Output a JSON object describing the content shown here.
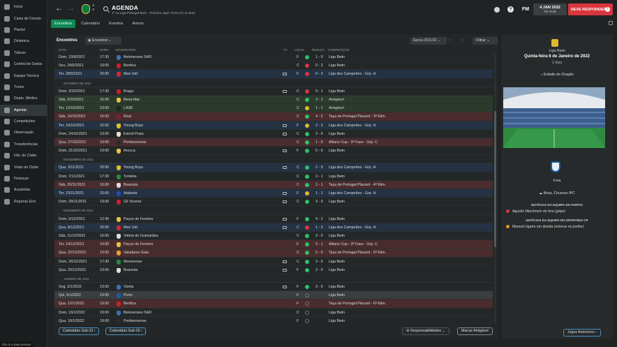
{
  "sidebar": {
    "items": [
      {
        "label": "Início",
        "active": false
      },
      {
        "label": "Caixa de Correio",
        "active": false
      },
      {
        "label": "Plantel",
        "active": false
      },
      {
        "label": "Dinâmica",
        "active": false
      },
      {
        "label": "Táticas",
        "active": false
      },
      {
        "label": "Central de Dados",
        "active": false
      },
      {
        "label": "Equipa Técnica",
        "active": false
      },
      {
        "label": "Treino",
        "active": false
      },
      {
        "label": "Depto. Médico",
        "active": false
      },
      {
        "label": "Agenda",
        "active": true
      },
      {
        "label": "Competições",
        "active": false
      },
      {
        "label": "Observação",
        "active": false
      },
      {
        "label": "Transferências",
        "active": false
      },
      {
        "label": "Info. do Clube",
        "active": false
      },
      {
        "label": "Visão do Clube",
        "active": false
      },
      {
        "label": "Finanças",
        "active": false
      },
      {
        "label": "Academia",
        "active": false
      },
      {
        "label": "Reportar Erro",
        "active": false
      }
    ],
    "beta_note": "This is a beta version"
  },
  "header": {
    "title": "AGENDA",
    "subtitle": "1º na Liga Portugal Bwin · Próximo Jogo: Porto (F) (2 dias)",
    "date": "4 JAN 2022",
    "time": "Ter 9:45",
    "fm_logo": "FM",
    "continue_label": "DEVE RESPONDER"
  },
  "tabs": [
    "Encontros",
    "Calendário",
    "Eventos",
    "Avisos"
  ],
  "main": {
    "heading": "Encontros",
    "filter_value": "Encontros",
    "season": "Época 2021/22",
    "filter_button": "Filtrar",
    "columns": [
      "DATA",
      "HORA",
      "ADVERSÁRIO",
      "TV",
      "LOCAL",
      "RESULT...",
      "COMPETIÇÃO"
    ],
    "rows": [
      {
        "type": "match",
        "date": "Dom, 19/9/2021",
        "time": "17:30",
        "opp": "Belenenses SAD",
        "tv": "",
        "venue": "F",
        "result": "1 - 0",
        "comp": "Liga Bwin",
        "tone": "",
        "crest": "#3b6fb6",
        "dot": "#2fbf6a"
      },
      {
        "type": "match",
        "date": "Sex, 24/9/2021",
        "time": "19:00",
        "opp": "Benfica",
        "tv": "",
        "venue": "C",
        "result": "0 - 2",
        "comp": "Liga Bwin",
        "tone": "",
        "crest": "#c8202a",
        "dot": "#d9363e"
      },
      {
        "type": "match",
        "date": "Ter, 28/9/2021",
        "time": "20:00",
        "opp": "Man Utd",
        "tv": "yes",
        "venue": "F",
        "result": "0 - 3",
        "comp": "Liga dos Campeões - Grp. H",
        "tone": "ts-cl",
        "crest": "#d42a2a",
        "dot": "#d9363e"
      },
      {
        "type": "month",
        "label": "OUTUBRO DE 2021"
      },
      {
        "type": "match",
        "date": "Dom, 3/10/2021",
        "time": "17:30",
        "opp": "Braga",
        "tv": "yes",
        "venue": "C",
        "result": "0 - 1",
        "comp": "Liga Bwin",
        "tone": "",
        "crest": "#c8202a",
        "dot": "#d9363e"
      },
      {
        "type": "match",
        "date": "Sáb, 9/10/2021",
        "time": "16:00",
        "opp": "Beira-Mar",
        "tv": "",
        "venue": "C",
        "result": "3 - 1",
        "comp": "Amigável",
        "tone": "ts-friendly",
        "crest": "#e8c240",
        "dot": "#2fbf6a"
      },
      {
        "type": "match",
        "date": "Ter, 12/10/2021",
        "time": "19:00",
        "opp": "LASK",
        "tv": "",
        "venue": "C",
        "result": "1 - 1",
        "comp": "Amigável",
        "tone": "ts-friendly",
        "crest": "#222",
        "dot": "#e0b92a"
      },
      {
        "type": "match",
        "date": "Sáb, 16/10/2021",
        "time": "16:00",
        "opp": "Real",
        "tv": "",
        "venue": "C",
        "result": "4 - 2",
        "comp": "Taça de Portugal Placard - 3ª Elim.",
        "tone": "ts-cup",
        "crest": "#7a2030",
        "dot": "#2fbf6a"
      },
      {
        "type": "match",
        "date": "Ter, 19/10/2021",
        "time": "20:00",
        "opp": "Young Boys",
        "tv": "yes",
        "venue": "F",
        "result": "2 - 2",
        "comp": "Liga dos Campeões - Grp. H",
        "tone": "ts-cl",
        "crest": "#e0c020",
        "dot": "#e0b92a"
      },
      {
        "type": "match",
        "date": "Dom, 24/10/2021",
        "time": "19:00",
        "opp": "Estoril Praia",
        "tv": "yes",
        "venue": "C",
        "result": "2 - 0",
        "comp": "Liga Bwin",
        "tone": "",
        "crest": "#e8e0d0",
        "dot": "#2fbf6a"
      },
      {
        "type": "match",
        "date": "Qua, 27/10/2021",
        "time": "19:00",
        "opp": "Portimonense",
        "tv": "",
        "venue": "C",
        "result": "1 - 0",
        "comp": "Allianz Cup - 3ª Fase - Grp. C",
        "tone": "ts-cup",
        "crest": "#2a2a2a",
        "dot": "#2fbf6a"
      },
      {
        "type": "match",
        "date": "Dom, 31/10/2021",
        "time": "19:00",
        "opp": "Arouca",
        "tv": "yes",
        "venue": "F",
        "result": "5 - 0",
        "comp": "Liga Bwin",
        "tone": "",
        "crest": "#e8c240",
        "dot": "#2fbf6a"
      },
      {
        "type": "month",
        "label": "NOVEMBRO DE 2021"
      },
      {
        "type": "match",
        "date": "Qua, 3/11/2021",
        "time": "20:00",
        "opp": "Young Boys",
        "tv": "yes",
        "venue": "C",
        "result": "2 - 0",
        "comp": "Liga dos Campeões - Grp. H",
        "tone": "ts-cl",
        "crest": "#e0c020",
        "dot": "#2fbf6a"
      },
      {
        "type": "match",
        "date": "Dom, 7/11/2021",
        "time": "17:30",
        "opp": "Tondela",
        "tv": "",
        "venue": "C",
        "result": "3 - 1",
        "comp": "Liga Bwin",
        "tone": "",
        "crest": "#2a8a3a",
        "dot": "#2fbf6a"
      },
      {
        "type": "match",
        "date": "Sáb, 20/11/2021",
        "time": "16:00",
        "opp": "Boavista",
        "tv": "",
        "venue": "C",
        "result": "2 - 1",
        "comp": "Taça de Portugal Placard - 4ª Elim.",
        "tone": "ts-cup",
        "crest": "#ddd",
        "dot": "#2fbf6a"
      },
      {
        "type": "match",
        "date": "Ter, 23/11/2021",
        "time": "20:00",
        "opp": "Atalanta",
        "tv": "yes",
        "venue": "F",
        "result": "1 - 1",
        "comp": "Liga dos Campeões - Grp. H",
        "tone": "ts-cl",
        "crest": "#2a4ab0",
        "dot": "#e0b92a"
      },
      {
        "type": "match",
        "date": "Dom, 28/11/2021",
        "time": "19:00",
        "opp": "Gil Vicente",
        "tv": "yes",
        "venue": "C",
        "result": "3 - 0",
        "comp": "Liga Bwin",
        "tone": "",
        "crest": "#c8202a",
        "dot": "#2fbf6a"
      },
      {
        "type": "month",
        "label": "DEZEMBRO DE 2021"
      },
      {
        "type": "match",
        "date": "Dom, 5/12/2021",
        "time": "12:45",
        "opp": "Paços de Ferreira",
        "tv": "yes",
        "venue": "F",
        "result": "4 - 2",
        "comp": "Liga Bwin",
        "tone": "",
        "crest": "#e8c240",
        "dot": "#2fbf6a"
      },
      {
        "type": "match",
        "date": "Qua, 8/12/2021",
        "time": "20:00",
        "opp": "Man Utd",
        "tv": "yes",
        "venue": "C",
        "result": "1 - 3",
        "comp": "Liga dos Campeões - Grp. H",
        "tone": "ts-cl",
        "crest": "#d42a2a",
        "dot": "#d9363e"
      },
      {
        "type": "match",
        "date": "Sáb, 11/12/2021",
        "time": "16:00",
        "opp": "Vitória de Guimarães",
        "tv": "",
        "venue": "C",
        "result": "3 - 0",
        "comp": "Liga Bwin",
        "tone": "",
        "crest": "#ddd",
        "dot": "#2fbf6a"
      },
      {
        "type": "match",
        "date": "Ter, 14/12/2021",
        "time": "19:00",
        "opp": "Paços de Ferreira",
        "tv": "",
        "venue": "F",
        "result": "3 - 1",
        "comp": "Allianz Cup - 3ª Fase - Grp. C",
        "tone": "ts-cup",
        "crest": "#e8c240",
        "dot": "#2fbf6a"
      },
      {
        "type": "match",
        "date": "Qua, 22/12/2021",
        "time": "19:00",
        "opp": "Valadares Gaia",
        "tv": "",
        "venue": "C",
        "result": "5 - 0",
        "comp": "Taça de Portugal Placard - 5ª Elim.",
        "tone": "ts-cup",
        "crest": "#e8a030",
        "dot": "#2fbf6a"
      },
      {
        "type": "match",
        "date": "Dom, 26/12/2021",
        "time": "17:30",
        "opp": "Moreirense",
        "tv": "yes",
        "venue": "C",
        "result": "3 - 0",
        "comp": "Liga Bwin",
        "tone": "",
        "crest": "#2a8a3a",
        "dot": "#2fbf6a"
      },
      {
        "type": "match",
        "date": "Qua, 29/12/2021",
        "time": "19:00",
        "opp": "Boavista",
        "tv": "yes",
        "venue": "F",
        "result": "2 - 0",
        "comp": "Liga Bwin",
        "tone": "",
        "crest": "#ddd",
        "dot": "#2fbf6a"
      },
      {
        "type": "month",
        "label": "JANEIRO DE 2022"
      },
      {
        "type": "match",
        "date": "Seg, 3/1/2022",
        "time": "19:00",
        "opp": "Vizela",
        "tv": "yes",
        "venue": "F",
        "result": "3 - 0",
        "comp": "Liga Bwin",
        "tone": "",
        "crest": "#3b6fb6",
        "dot": "#2fbf6a"
      },
      {
        "type": "match",
        "date": "Qui, 6/1/2022",
        "time": "19:00",
        "opp": "Porto",
        "tv": "",
        "venue": "F",
        "result": "",
        "comp": "Liga Bwin",
        "tone": "ts-next",
        "crest": "#1d5aa8",
        "dot": ""
      },
      {
        "type": "match",
        "date": "Qua, 12/1/2022",
        "time": "19:00",
        "opp": "Benfica",
        "tv": "",
        "venue": "F",
        "result": "",
        "comp": "Taça de Portugal Placard - 6ª Elim.",
        "tone": "ts-cup",
        "crest": "#c8202a",
        "dot": ""
      },
      {
        "type": "match",
        "date": "Dom, 16/1/2022",
        "time": "19:00",
        "opp": "Belenenses SAD",
        "tv": "",
        "venue": "C",
        "result": "",
        "comp": "Liga Bwin",
        "tone": "",
        "crest": "#3b6fb6",
        "dot": ""
      },
      {
        "type": "match",
        "date": "Qua, 19/1/2022",
        "time": "19:00",
        "opp": "Portimonense",
        "tv": "",
        "venue": "F",
        "result": "",
        "comp": "Liga Bwin",
        "tone": "",
        "crest": "#2a2a2a",
        "dot": ""
      }
    ]
  },
  "bottom": {
    "cal_u23": "Calendário Sub-23",
    "cal_u19": "Calendário Sub-19",
    "responsibilities": "Responsabilidades",
    "friendly": "Marcar Amigável",
    "prev_matches": "Jogos Anteriores"
  },
  "next_match": {
    "competition": "Liga Bwin",
    "date_long": "Quinta-feira 6 de Janeiro de 2022",
    "days": "2 dias",
    "stadium": "Estádio do Dragão",
    "venue": "Fora",
    "weather": "Brisa, Chuvoso 8ºC",
    "news_opp_head": "NOTÍCIAS DA EQUIPA DO PORTO",
    "news_opp_item": "Agustín Marchesín de fora (gripe)",
    "news_own_head": "NOTÍCIAS DA EQUIPA DO SPORTING CP",
    "news_own_item": "Manuel Ugarte em dúvida (entorse no joelho)"
  },
  "colors": {
    "accent": "#0e8a55",
    "alert": "#d9363e",
    "win": "#2fbf6a",
    "draw": "#e0b92a",
    "loss": "#d9363e"
  }
}
